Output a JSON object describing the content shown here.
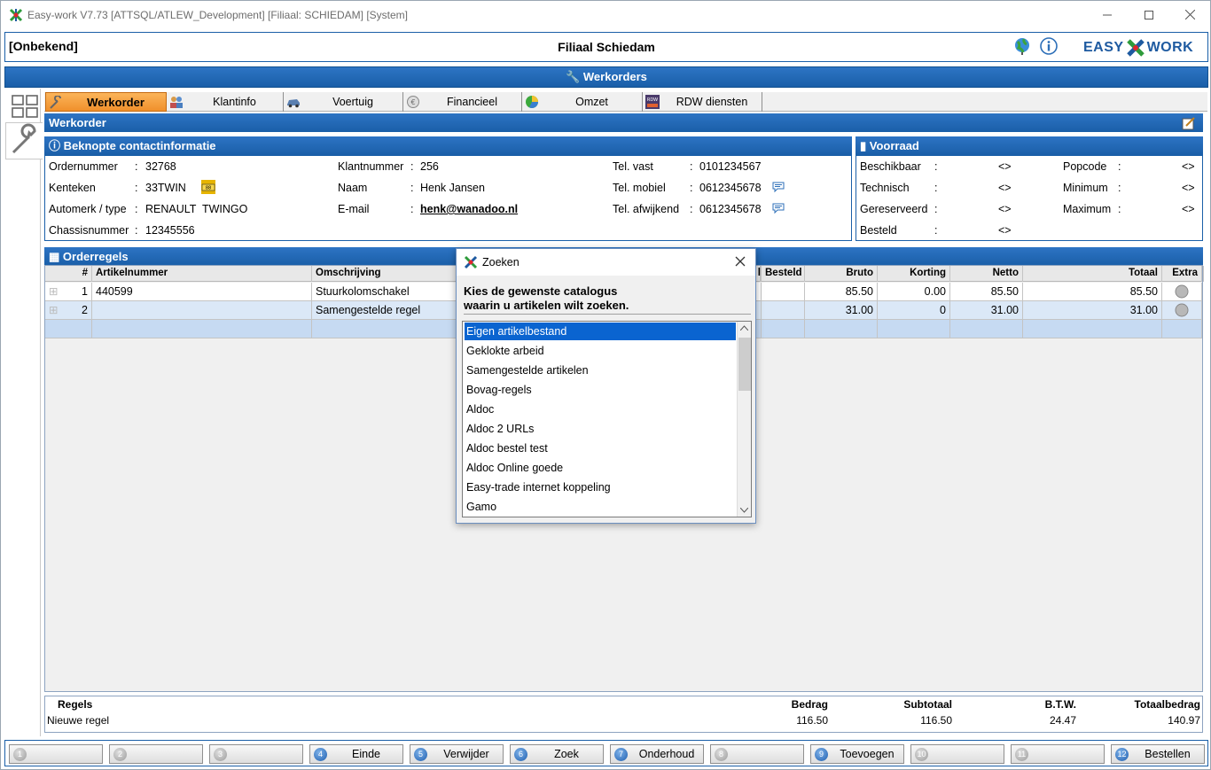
{
  "window": {
    "title": "Easy-work V7.73 [ATTSQL/ATLEW_Development] [Filiaal: SCHIEDAM] [System]"
  },
  "header": {
    "left": "[Onbekend]",
    "center": "Filiaal Schiedam",
    "brand_left": "EASY",
    "brand_right": "WORK"
  },
  "main_bar": {
    "title": "Werkorders"
  },
  "tabs": [
    {
      "label": "Werkorder",
      "icon": "wrench-icon"
    },
    {
      "label": "Klantinfo",
      "icon": "users-icon"
    },
    {
      "label": "Voertuig",
      "icon": "car-icon"
    },
    {
      "label": "Financieel",
      "icon": "coin-icon"
    },
    {
      "label": "Omzet",
      "icon": "chart-icon"
    },
    {
      "label": "RDW diensten",
      "icon": "rdw-icon"
    }
  ],
  "werkorder_bar": {
    "title": "Werkorder"
  },
  "contact": {
    "title": "Beknopte contactinformatie",
    "ordernummer_label": "Ordernummer",
    "ordernummer": "32768",
    "kenteken_label": "Kenteken",
    "kenteken": "33TWIN",
    "automerk_label": "Automerk / type",
    "automerk": "RENAULT",
    "type": "TWINGO",
    "chassis_label": "Chassisnummer",
    "chassis": "12345556",
    "klantnummer_label": "Klantnummer",
    "klantnummer": "256",
    "naam_label": "Naam",
    "naam": "Henk Jansen",
    "email_label": "E-mail",
    "email": "henk@wanadoo.nl",
    "tel_vast_label": "Tel. vast",
    "tel_vast": "0101234567",
    "tel_mobiel_label": "Tel. mobiel",
    "tel_mobiel": "0612345678",
    "tel_afw_label": "Tel. afwijkend",
    "tel_afw": "0612345678",
    "colon": ":"
  },
  "voorraad": {
    "title": "Voorraad",
    "beschikbaar_label": "Beschikbaar",
    "beschikbaar": "<>",
    "technisch_label": "Technisch",
    "technisch": "<>",
    "gereserveerd_label": "Gereserveerd",
    "gereserveerd": "<>",
    "besteld_label": "Besteld",
    "besteld": "<>",
    "popcode_label": "Popcode",
    "popcode": "<>",
    "minimum_label": "Minimum",
    "minimum": "<>",
    "maximum_label": "Maximum",
    "maximum": "<>"
  },
  "orderregels": {
    "title": "Orderregels",
    "headers": {
      "nr": "#",
      "artikel": "Artikelnummer",
      "omschrijving": "Omschrijving",
      "col_l": "l",
      "besteld": "Besteld",
      "bruto": "Bruto",
      "korting": "Korting",
      "netto": "Netto",
      "totaal": "Totaal",
      "extra": "Extra"
    },
    "rows": [
      {
        "nr": "1",
        "artikel": "440599",
        "omschrijving": "Stuurkolomschakel",
        "bruto": "85.50",
        "korting": "0.00",
        "netto": "85.50",
        "totaal": "85.50"
      },
      {
        "nr": "2",
        "artikel": "",
        "omschrijving": "Samengestelde regel",
        "bruto": "31.00",
        "korting": "0",
        "netto": "31.00",
        "totaal": "31.00"
      }
    ]
  },
  "footer": {
    "regels_label": "Regels",
    "regels_value": "Nieuwe regel",
    "bedrag_label": "Bedrag",
    "bedrag": "116.50",
    "subtotaal_label": "Subtotaal",
    "subtotaal": "116.50",
    "btw_label": "B.T.W.",
    "btw": "24.47",
    "totaal_label": "Totaalbedrag",
    "totaal": "140.97"
  },
  "fkeys": [
    {
      "n": "1",
      "label": "",
      "on": false
    },
    {
      "n": "2",
      "label": "",
      "on": false
    },
    {
      "n": "3",
      "label": "",
      "on": false
    },
    {
      "n": "4",
      "label": "Einde",
      "on": true
    },
    {
      "n": "5",
      "label": "Verwijder",
      "on": true
    },
    {
      "n": "6",
      "label": "Zoek",
      "on": true
    },
    {
      "n": "7",
      "label": "Onderhoud",
      "on": true
    },
    {
      "n": "8",
      "label": "",
      "on": false
    },
    {
      "n": "9",
      "label": "Toevoegen",
      "on": true
    },
    {
      "n": "10",
      "label": "",
      "on": false
    },
    {
      "n": "11",
      "label": "",
      "on": false
    },
    {
      "n": "12",
      "label": "Bestellen",
      "on": true
    }
  ],
  "dialog": {
    "title": "Zoeken",
    "prompt_line1": "Kies de gewenste catalogus",
    "prompt_line2": "waarin u artikelen wilt zoeken.",
    "items": [
      "Eigen artikelbestand",
      "Geklokte arbeid",
      "Samengestelde artikelen",
      "Bovag-regels",
      "Aldoc",
      "Aldoc 2 URLs",
      "Aldoc bestel test",
      "Aldoc Online goede",
      "Easy-trade internet koppeling",
      "Gamo"
    ],
    "selected": "Eigen artikelbestand"
  },
  "colors": {
    "accent": "#1a5fa8",
    "tab_active": "#f0902b",
    "selection": "#0a64d0"
  }
}
